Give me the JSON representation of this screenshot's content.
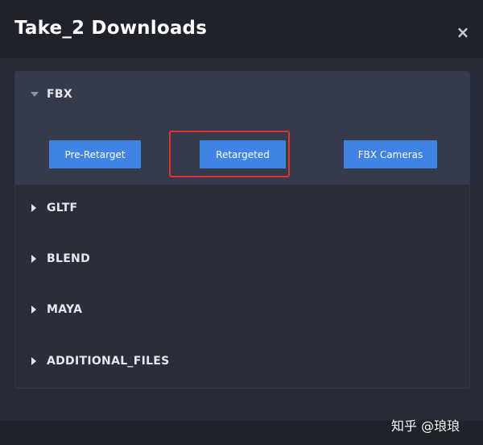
{
  "dialog": {
    "title": "Take_2 Downloads",
    "close_symbol": "×"
  },
  "sections": [
    {
      "label": "FBX",
      "expanded": true,
      "buttons": [
        "Pre-Retarget",
        "Retargeted",
        "FBX Cameras"
      ],
      "highlighted_button": "Retargeted"
    },
    {
      "label": "GLTF",
      "expanded": false
    },
    {
      "label": "BLEND",
      "expanded": false
    },
    {
      "label": "MAYA",
      "expanded": false
    },
    {
      "label": "ADDITIONAL_FILES",
      "expanded": false
    }
  ],
  "watermark": "知乎 @琅琅",
  "colors": {
    "background": "#262a36",
    "header": "#1f222b",
    "expanded_section": "#363b4b",
    "button": "#3f84e5",
    "highlight": "#e5312f"
  }
}
